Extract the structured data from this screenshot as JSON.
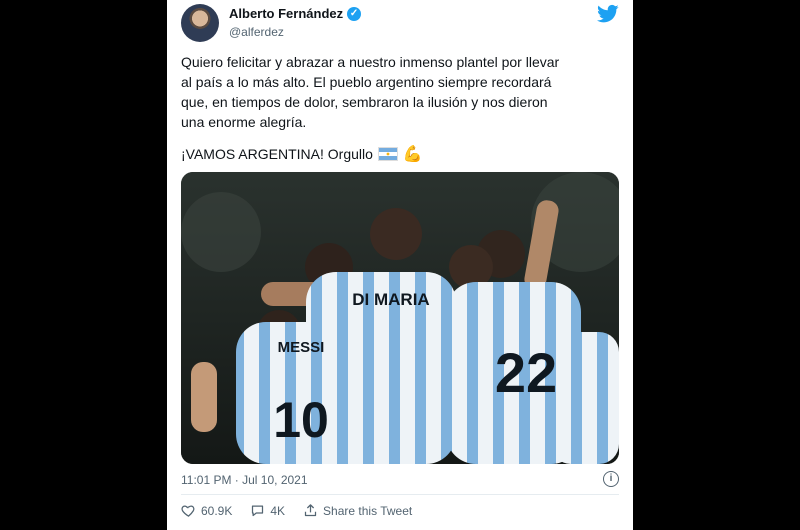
{
  "user": {
    "name": "Alberto Fernández",
    "handle": "@alferdez"
  },
  "tweet": {
    "text": "Quiero felicitar y abrazar a nuestro inmenso plantel por llevar\nal país a lo más alto. El pueblo argentino siempre recordará\nque, en tiempos de dolor, sembraron la ilusión y nos dieron\nuna enorme alegría.",
    "tagline": "¡VAMOS ARGENTINA! Orgullo",
    "emoji_flag": "🇦🇷",
    "emoji_flex": "💪",
    "timestamp": "11:01 PM · Jul 10, 2021"
  },
  "photo": {
    "jersey_name_1": "DI MARIA",
    "jersey_name_2": "MESSI",
    "number_1": "10",
    "number_2": "22"
  },
  "actions": {
    "likes": "60.9K",
    "replies": "4K",
    "share_label": "Share this Tweet"
  },
  "colors": {
    "twitter_blue": "#1da1f2",
    "text": "#0f1419",
    "muted": "#536471",
    "argentina_blue": "#74acdf"
  },
  "icons": {
    "logo": "twitter-bird-icon",
    "verified": "verified-badge-icon",
    "info": "info-icon",
    "like": "heart-icon",
    "reply": "reply-icon",
    "share": "share-icon"
  }
}
